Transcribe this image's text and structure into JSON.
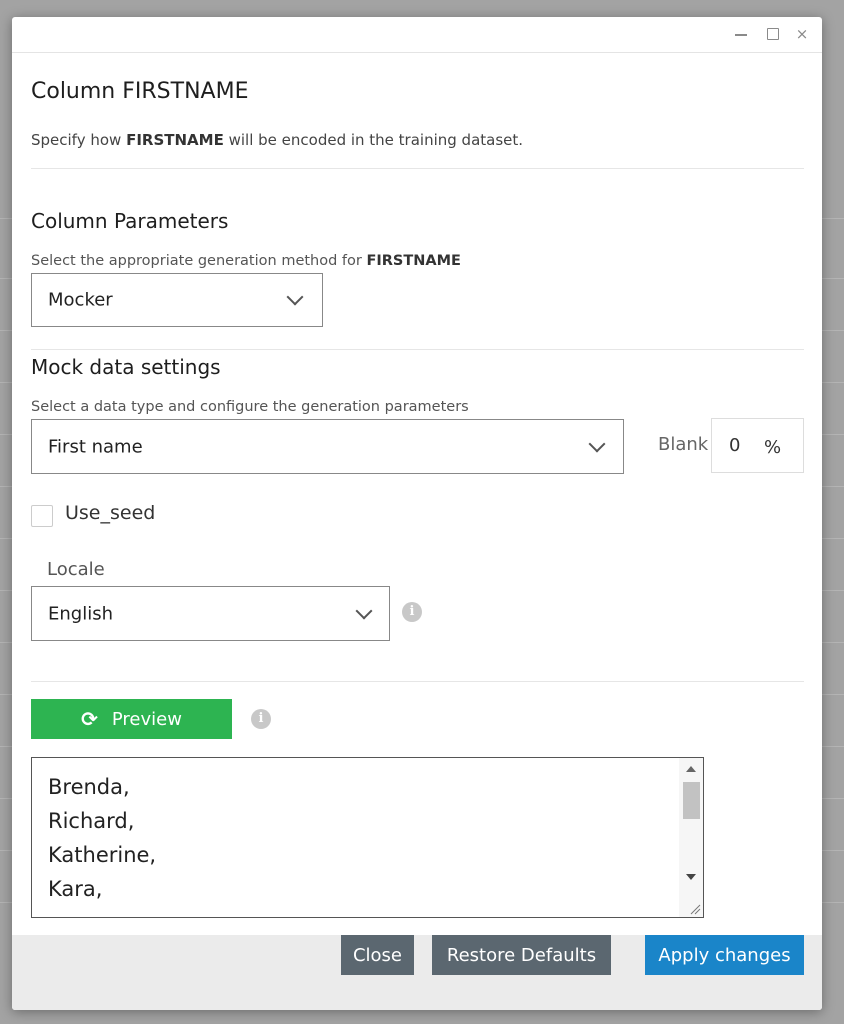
{
  "window": {
    "controls": {
      "minimize": "—",
      "maximize": "☐",
      "close": "×"
    }
  },
  "dialog": {
    "title": "Column FIRSTNAME",
    "subtitle_prefix": "Specify how ",
    "subtitle_column": "FIRSTNAME",
    "subtitle_suffix": " will be encoded in the training dataset."
  },
  "column_parameters": {
    "heading": "Column Parameters",
    "method_label_prefix": "Select the appropriate generation method for ",
    "method_label_column": "FIRSTNAME",
    "method_value": "Mocker"
  },
  "mock_settings": {
    "heading": "Mock data settings",
    "type_label": "Select a data type and configure the generation parameters",
    "data_type_value": "First name",
    "blank_label": "Blank",
    "blank_value": "0",
    "blank_unit": "%",
    "use_seed_label": "Use_seed",
    "use_seed_checked": false,
    "locale_label": "Locale",
    "locale_value": "English",
    "info_glyph": "i"
  },
  "preview": {
    "button_label": "Preview",
    "icon": "refresh-icon",
    "lines": [
      "Brenda,",
      "Richard,",
      "Katherine,",
      "Kara,"
    ]
  },
  "footer": {
    "close_label": "Close",
    "restore_label": "Restore Defaults",
    "apply_label": "Apply changes"
  },
  "colors": {
    "preview_button": "#2db451",
    "apply_button": "#1a85c9",
    "secondary_button": "#5b6770",
    "footer_bg": "#ebebeb"
  }
}
